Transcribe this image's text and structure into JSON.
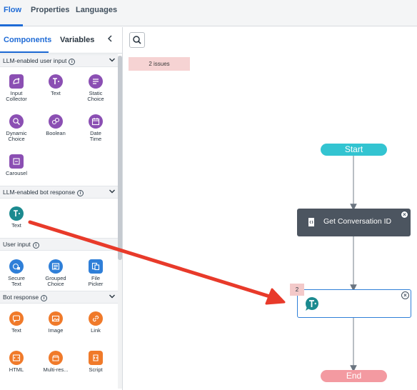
{
  "top_tabs": {
    "flow": "Flow",
    "properties": "Properties",
    "languages": "Languages"
  },
  "left_panel": {
    "tabs": {
      "components": "Components",
      "variables": "Variables"
    },
    "sections": {
      "llm_user_input": {
        "title": "LLM-enabled user input",
        "items": {
          "input_collector": "Input\nCollector",
          "text": "Text",
          "static_choice": "Static\nChoice",
          "dynamic_choice": "Dynamic\nChoice",
          "boolean": "Boolean",
          "date_time": "Date\nTime",
          "carousel": "Carousel"
        }
      },
      "llm_bot_response": {
        "title": "LLM-enabled bot response",
        "items": {
          "text": "Text"
        }
      },
      "user_input": {
        "title": "User input",
        "items": {
          "secure_text": "Secure\nText",
          "grouped_choice": "Grouped\nChoice",
          "file_picker": "File\nPicker"
        }
      },
      "bot_response": {
        "title": "Bot response",
        "items": {
          "text": "Text",
          "image": "Image",
          "link": "Link",
          "html": "HTML",
          "multi_response": "Multi-res...",
          "script": "Script"
        }
      }
    }
  },
  "canvas": {
    "issues": "2 issues",
    "nodes": {
      "start": "Start",
      "get_conversation_id": "Get Conversation ID",
      "text_node_badge": "2",
      "end": "End"
    }
  },
  "icons": {
    "search": "search-icon",
    "collapse": "chevron-left-icon",
    "section_toggle": "chevron-down-icon",
    "info": "info-icon",
    "close": "close-icon"
  },
  "colors": {
    "accent": "#1f6bd6",
    "llm_input": "#8b4fb3",
    "llm_response": "#1b8a8f",
    "user_input": "#2f7fd8",
    "bot_response": "#f07a2a",
    "start_node": "#33c4d1",
    "end_node": "#f39aa1",
    "script_node": "#4c5560",
    "annotation_arrow": "#e83a2a",
    "issues_bg": "#f6d3d3"
  }
}
